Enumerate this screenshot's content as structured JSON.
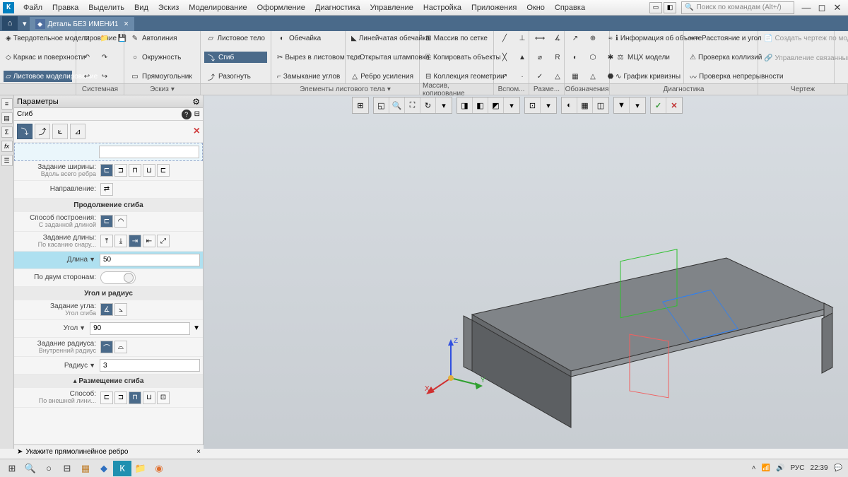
{
  "menu": [
    "Файл",
    "Правка",
    "Выделить",
    "Вид",
    "Эскиз",
    "Моделирование",
    "Оформление",
    "Диагностика",
    "Управление",
    "Настройка",
    "Приложения",
    "Окно",
    "Справка"
  ],
  "search_placeholder": "Поиск по командам (Alt+/)",
  "tab": {
    "title": "Деталь БЕЗ ИМЕНИ1"
  },
  "ribbon": {
    "g1": {
      "r1": "Твердотельное моделирование",
      "r2": "Каркас и поверхности",
      "r3": "Листовое моделирование"
    },
    "g2": {
      "autoline": "Автолиния",
      "circle": "Окружность",
      "rect": "Прямоугольник"
    },
    "g3": {
      "sheet": "Листовое тело",
      "bend": "Сгиб",
      "unbend": "Разогнуть"
    },
    "g4": {
      "shell": "Обечайка",
      "cut": "Вырез в листовом теле",
      "closecorner": "Замыкание углов"
    },
    "g5": {
      "ruled": "Линейчатая обечайка",
      "open": "Открытая штамповка",
      "rib": "Ребро усиления"
    },
    "g6": {
      "grid": "Массив по сетке",
      "copy": "Копировать объекты",
      "collection": "Коллекция геометрии"
    },
    "g7": {
      "info": "Информация об объекте",
      "mass": "МЦХ модели",
      "curve": "График кривизны"
    },
    "g8": {
      "dist": "Расстояние и угол",
      "collision": "Проверка коллизий",
      "cont": "Проверка непрерывности"
    },
    "g9": {
      "draw": "Создать чертеж по модели",
      "manage": "Управление связанными ч..."
    }
  },
  "ribfoot": [
    "",
    "Системная",
    "Эскиз",
    "",
    "Элементы листового тела",
    "",
    "Массив, копирование",
    "Вспом...",
    "Разме...",
    "Обозначения",
    "Диагностика",
    "Чертеж"
  ],
  "params": {
    "title": "Параметры",
    "opname": "Сгиб",
    "width_label": "Задание ширины:",
    "width_sub": "Вдоль всего ребра",
    "direction": "Направление:",
    "sect_extend": "Продолжение сгиба",
    "build_label": "Способ построения:",
    "build_sub": "С заданной длиной",
    "len_label": "Задание длины:",
    "len_sub": "По касанию снару...",
    "length": "Длина",
    "length_val": "50",
    "twosides": "По двум сторонам:",
    "sect_angle": "Угол и радиус",
    "angle_label": "Задание угла:",
    "angle_sub": "Угол сгиба",
    "angle": "Угол",
    "angle_val": "90",
    "radius_label": "Задание радиуса:",
    "radius_sub": "Внутренний радиус",
    "radius": "Радиус",
    "radius_val": "3",
    "sect_place": "Размещение сгиба",
    "place_label": "Способ:",
    "place_sub": "По внешней лини..."
  },
  "statusbar": "Укажите прямолинейное ребро",
  "taskbar": {
    "lang": "РУС",
    "time": "22:39"
  }
}
